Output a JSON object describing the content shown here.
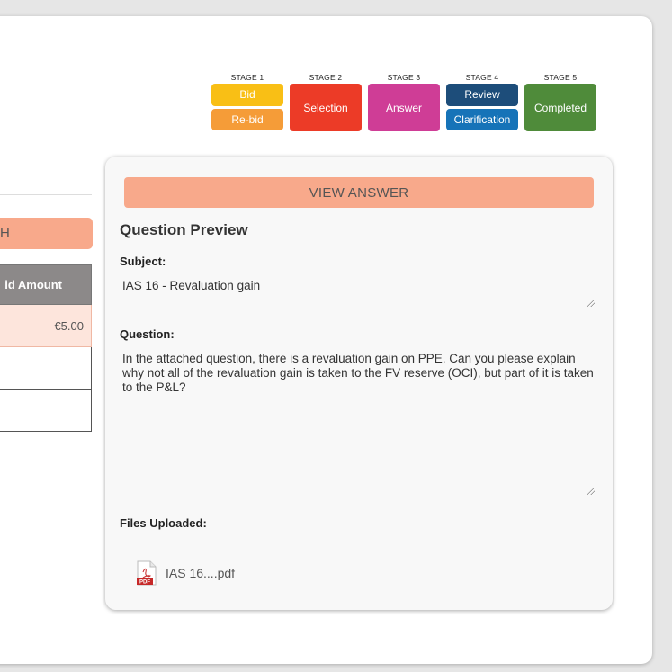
{
  "stages": [
    {
      "label": "STAGE 1",
      "buttons": [
        {
          "text": "Bid",
          "color": "#f9bf15"
        },
        {
          "text": "Re-bid",
          "color": "#f59c38"
        }
      ]
    },
    {
      "label": "STAGE 2",
      "buttons": [
        {
          "text": "Selection",
          "color": "#ec3b27"
        }
      ]
    },
    {
      "label": "STAGE 3",
      "buttons": [
        {
          "text": "Answer",
          "color": "#cf3d96"
        }
      ]
    },
    {
      "label": "STAGE 4",
      "buttons": [
        {
          "text": "Review",
          "color": "#1d4d7a"
        },
        {
          "text": "Clarification",
          "color": "#1673b8"
        }
      ]
    },
    {
      "label": "STAGE 5",
      "buttons": [
        {
          "text": "Completed",
          "color": "#4f8b3a"
        }
      ]
    }
  ],
  "left": {
    "search_label": "H",
    "table": {
      "header": "id Amount",
      "rows": [
        "€5.00",
        "",
        ""
      ]
    }
  },
  "preview": {
    "view_answer_label": "VIEW ANSWER",
    "title": "Question Preview",
    "subject_label": "Subject:",
    "subject_value": "IAS 16 - Revaluation gain",
    "question_label": "Question:",
    "question_value": "In the attached question, there is a revaluation gain on PPE. Can you please explain why not all of the revaluation gain is taken to the FV reserve (OCI), but part of it is taken to the P&L?",
    "files_label": "Files Uploaded:",
    "files": [
      {
        "name": "IAS 16....pdf",
        "icon": "pdf-file-icon"
      }
    ]
  },
  "colors": {
    "accent": "#f8a98b",
    "highlight_row": "#fde5dc",
    "table_header": "#8c8989"
  }
}
